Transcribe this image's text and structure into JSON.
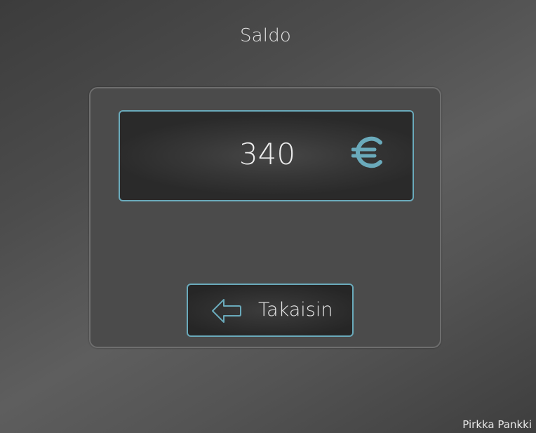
{
  "screen": {
    "title": "Saldo"
  },
  "balance": {
    "amount": "340",
    "currency_icon": "euro-icon",
    "currency_symbol": "€"
  },
  "actions": {
    "back_label": "Takaisin",
    "back_icon": "arrow-left-icon"
  },
  "footer": {
    "brand": "Pirkka Pankki"
  },
  "colors": {
    "accent": "#6aaabb",
    "text": "#e6e6e6",
    "panel": "#4b4b4b",
    "field": "#2f2f2f"
  }
}
